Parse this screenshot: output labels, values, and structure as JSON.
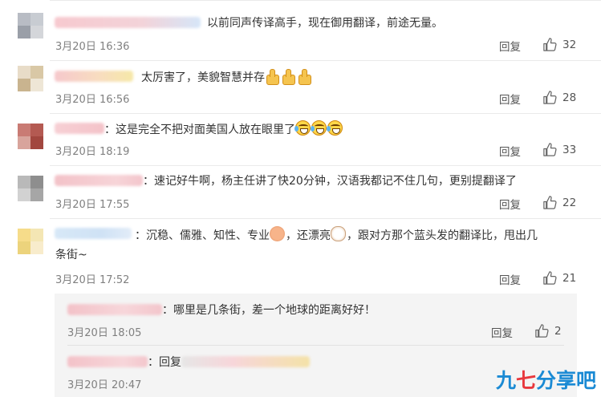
{
  "reply_label": "回复",
  "comments": [
    {
      "text": "以前同声传译高手，现在御用翻译，前途无量。",
      "time": "3月20日 16:36",
      "likes": "32"
    },
    {
      "text": "太厉害了，美貌智慧并存",
      "time": "3月20日 16:56",
      "likes": "28"
    },
    {
      "text": "：这是完全不把对面美国人放在眼里了",
      "time": "3月20日 18:19",
      "likes": "33"
    },
    {
      "text": "：速记好牛啊，杨主任讲了快20分钟，汉语我都记不住几句，更别提翻译了",
      "time": "3月20日 17:55",
      "likes": "22"
    },
    {
      "text_a": "：沉稳、儒雅、知性、专业",
      "text_b": "，还漂亮",
      "text_c": "，跟对方那个蓝头发的翻译比，甩出几",
      "text_line2": "条街~",
      "time": "3月20日 17:52",
      "likes": "21"
    }
  ],
  "sub_replies": [
    {
      "text": "：哪里是几条街，差一个地球的距离好好！",
      "time": "3月20日 18:05",
      "likes": "2"
    },
    {
      "text": "：回复",
      "time": "3月20日 20:47"
    }
  ],
  "watermark": {
    "part1": "九",
    "part2": "七",
    "part3": "分享吧"
  },
  "icons": {
    "like": "thumbs-up-icon",
    "emoji_thumb": "thumbs-up-emoji",
    "emoji_laugh": "laugh-cry-emoji"
  },
  "colors": {
    "time": "#808080",
    "text": "#333333",
    "watermark_blue": "#1a8ad4",
    "watermark_red": "#e8383d"
  }
}
